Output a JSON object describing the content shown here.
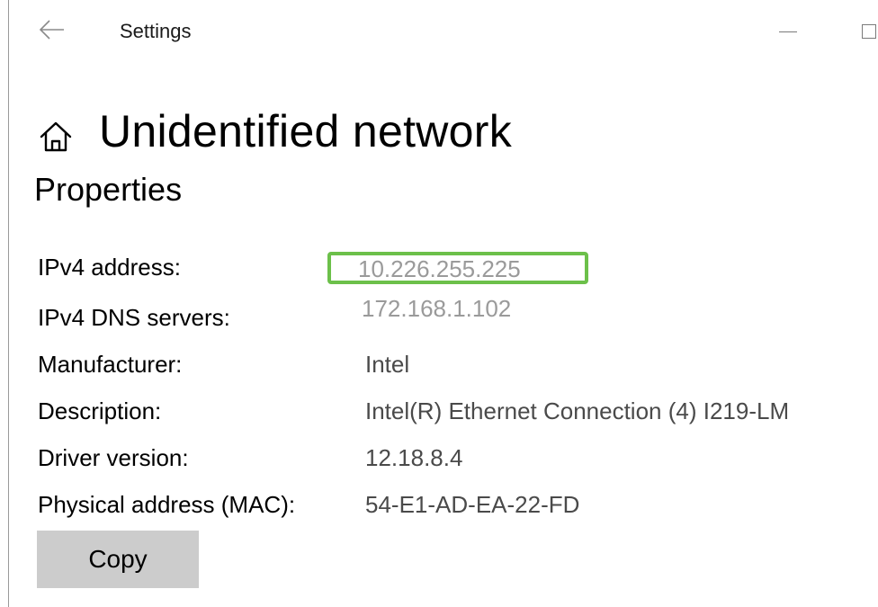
{
  "titlebar": {
    "title": "Settings",
    "back_icon": "back-arrow-icon",
    "minimize_icon": "minimize-icon",
    "maximize_icon": "maximize-icon"
  },
  "header": {
    "home_icon": "home-icon",
    "title": "Unidentified network"
  },
  "section": {
    "title": "Properties"
  },
  "properties": [
    {
      "label": "IPv4 address:",
      "value": "10.226.255.225"
    },
    {
      "label": "IPv4 DNS servers:",
      "value": "172.168.1.102"
    },
    {
      "label": "Manufacturer:",
      "value": "Intel"
    },
    {
      "label": "Description:",
      "value": "Intel(R) Ethernet Connection (4) I219-LM"
    },
    {
      "label": "Driver version:",
      "value": "12.18.8.4"
    },
    {
      "label": "Physical address (MAC):",
      "value": "54-E1-AD-EA-22-FD"
    }
  ],
  "actions": {
    "copy_label": "Copy"
  },
  "colors": {
    "highlight_border": "#6cc04a",
    "button_bg": "#cccccc",
    "muted_value": "#9a9a9a"
  }
}
